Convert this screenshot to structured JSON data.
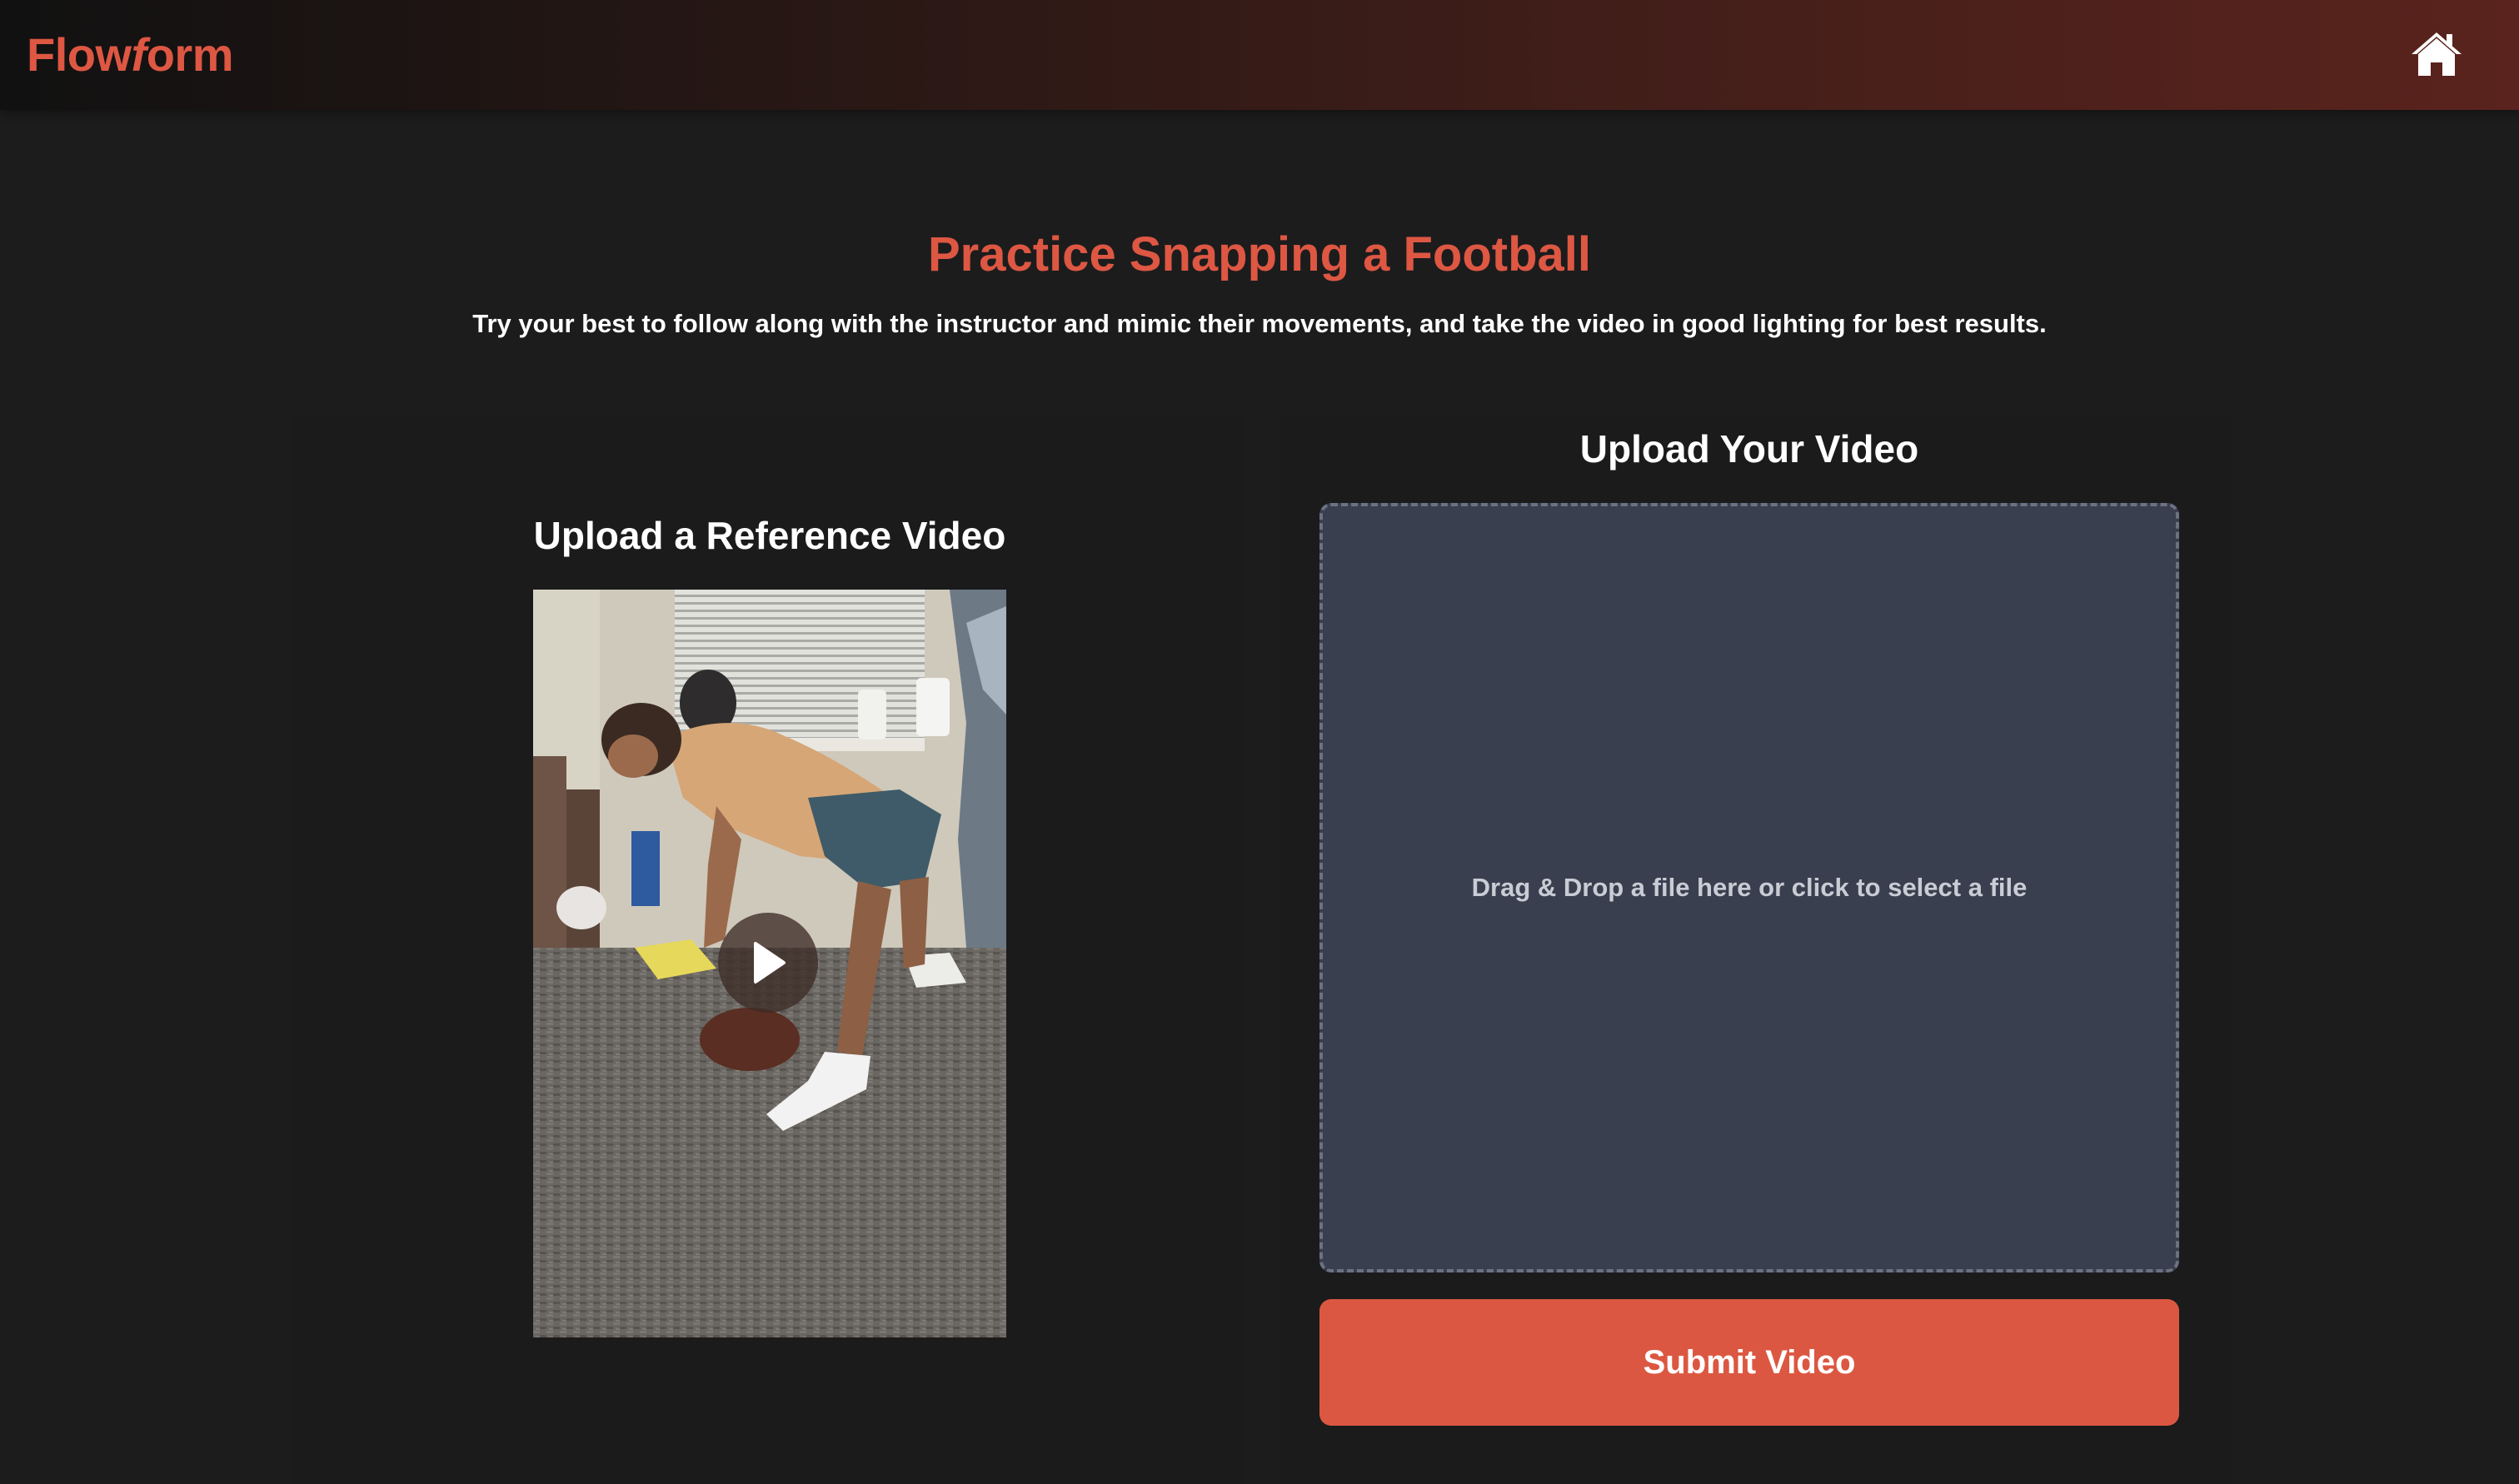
{
  "colors": {
    "accent": "#dd5743",
    "background": "#1c1c1d",
    "dropzone_bg": "#3a3f4f",
    "submit_bg": "#dc5741"
  },
  "header": {
    "brand_part1": "Flow",
    "brand_part2": "f",
    "brand_part3": "orm",
    "home_icon": "home-icon"
  },
  "hero": {
    "title": "Practice Snapping a Football",
    "subtitle": "Try your best to follow along with the instructor and mimic their movements, and take the video in good lighting for best results."
  },
  "reference": {
    "heading": "Upload a Reference Video",
    "play_icon": "play-icon"
  },
  "upload": {
    "heading": "Upload Your Video",
    "dropzone_text": "Drag & Drop a file here or click to select a file",
    "submit_label": "Submit Video"
  }
}
